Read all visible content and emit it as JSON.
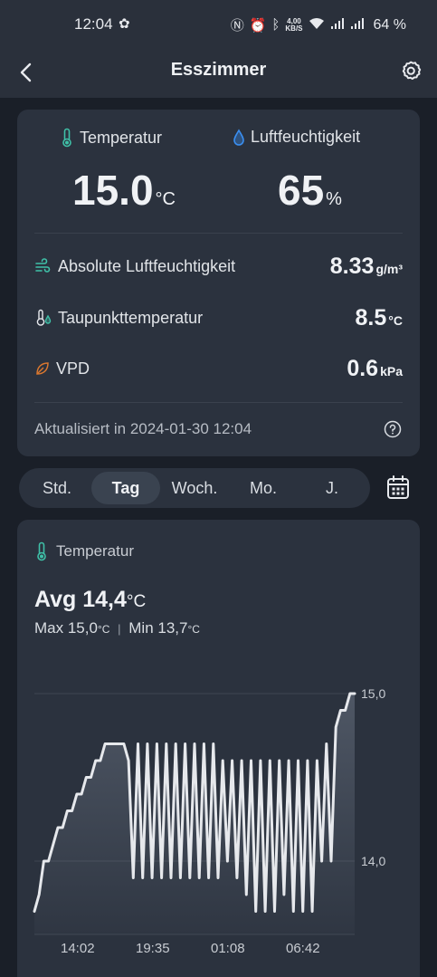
{
  "status": {
    "time": "12:04",
    "speed_top": "4,00",
    "speed_bottom": "KB/S",
    "battery": "64 %"
  },
  "appbar": {
    "title": "Esszimmer"
  },
  "summary": {
    "temp_label": "Temperatur",
    "temp_value": "15.0",
    "temp_unit": "°C",
    "hum_label": "Luftfeuchtigkeit",
    "hum_value": "65",
    "hum_unit": "%",
    "rows": [
      {
        "label": "Absolute Luftfeuchtigkeit",
        "value": "8.33",
        "unit": "g/m³"
      },
      {
        "label": "Taupunkttemperatur",
        "value": "8.5",
        "unit": "°C"
      },
      {
        "label": "VPD",
        "value": "0.6",
        "unit": "kPa"
      }
    ],
    "updated": "Aktualisiert in 2024-01-30 12:04"
  },
  "tabs": [
    "Std.",
    "Tag",
    "Woch.",
    "Mo.",
    "J."
  ],
  "active_tab": "Tag",
  "chart_card": {
    "title": "Temperatur",
    "avg_label": "Avg 14,4",
    "avg_unit": "°C",
    "max_label": "Max 15,0",
    "min_label": "Min 13,7",
    "unit": "°C",
    "separator": "|"
  },
  "colors": {
    "accent_teal": "#3fc1a8",
    "accent_blue": "#3a8ef0",
    "accent_orange": "#d9772f",
    "line": "#e6e8ec"
  },
  "chart_data": {
    "type": "line",
    "title": "Temperatur",
    "x_ticks": [
      "14:02",
      "19:35",
      "01:08",
      "06:42"
    ],
    "y_ticks": [
      "15,0",
      "14,0"
    ],
    "y_tick_values": [
      15.0,
      14.0
    ],
    "ylim": [
      13.7,
      15.0
    ],
    "grid": true,
    "series": [
      {
        "values": [
          13.7,
          13.8,
          14.0,
          14.0,
          14.1,
          14.2,
          14.2,
          14.3,
          14.3,
          14.4,
          14.4,
          14.5,
          14.5,
          14.6,
          14.6,
          14.7,
          14.7,
          14.7,
          14.7,
          14.7,
          14.6,
          13.9,
          14.7,
          13.9,
          14.7,
          13.9,
          14.7,
          13.9,
          14.7,
          13.9,
          14.7,
          13.9,
          14.7,
          13.9,
          14.7,
          13.9,
          14.7,
          13.9,
          14.7,
          13.9,
          14.6,
          14.0,
          14.6,
          13.9,
          14.6,
          13.8,
          14.6,
          13.7,
          14.6,
          13.7,
          14.6,
          13.7,
          14.6,
          13.8,
          14.6,
          13.7,
          14.6,
          13.7,
          14.6,
          13.7,
          14.6,
          14.0,
          14.7,
          14.0,
          14.8,
          14.9,
          14.9,
          15.0,
          15.0
        ]
      }
    ]
  }
}
